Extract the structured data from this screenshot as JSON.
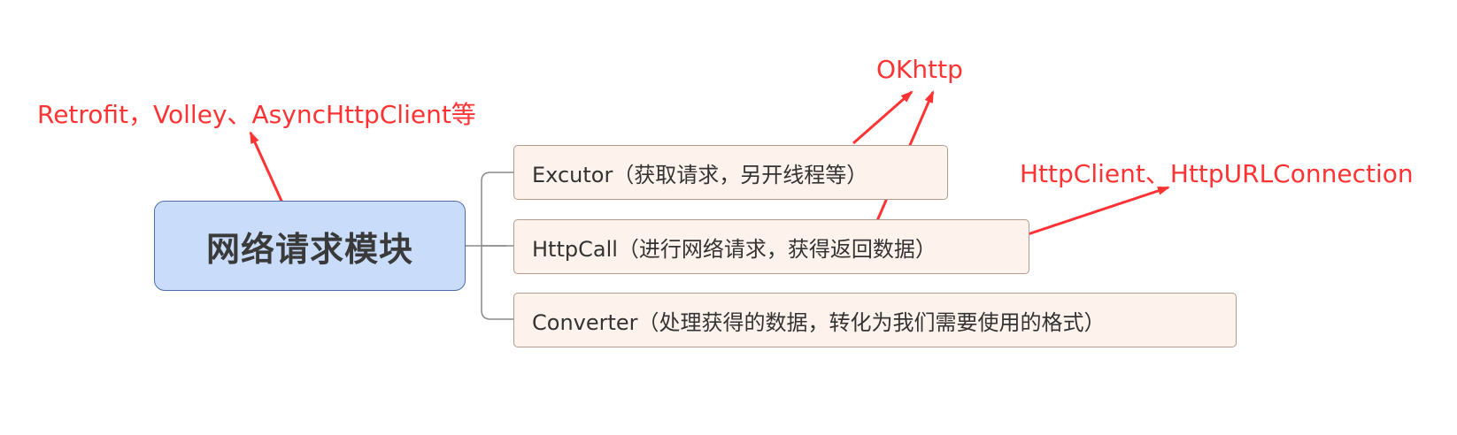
{
  "mindmap": {
    "root": {
      "label": "网络请求模块"
    },
    "children": [
      {
        "label": "Excutor（获取请求，另开线程等）"
      },
      {
        "label": "HttpCall（进行网络请求，获得返回数据）"
      },
      {
        "label": "Converter（处理获得的数据，转化为我们需要使用的格式）"
      }
    ]
  },
  "annotations": {
    "retrofit": "Retrofit，Volley、AsyncHttpClient等",
    "okhttp": "OKhttp",
    "httpclient": "HttpClient、HttpURLConnection"
  },
  "colors": {
    "root_fill": "#c9ddfa",
    "root_border": "#4f6fa8",
    "child_fill": "#fdf3ec",
    "child_border": "#b59b8c",
    "annotation": "#ff3333",
    "connector": "#8a8a8a"
  }
}
